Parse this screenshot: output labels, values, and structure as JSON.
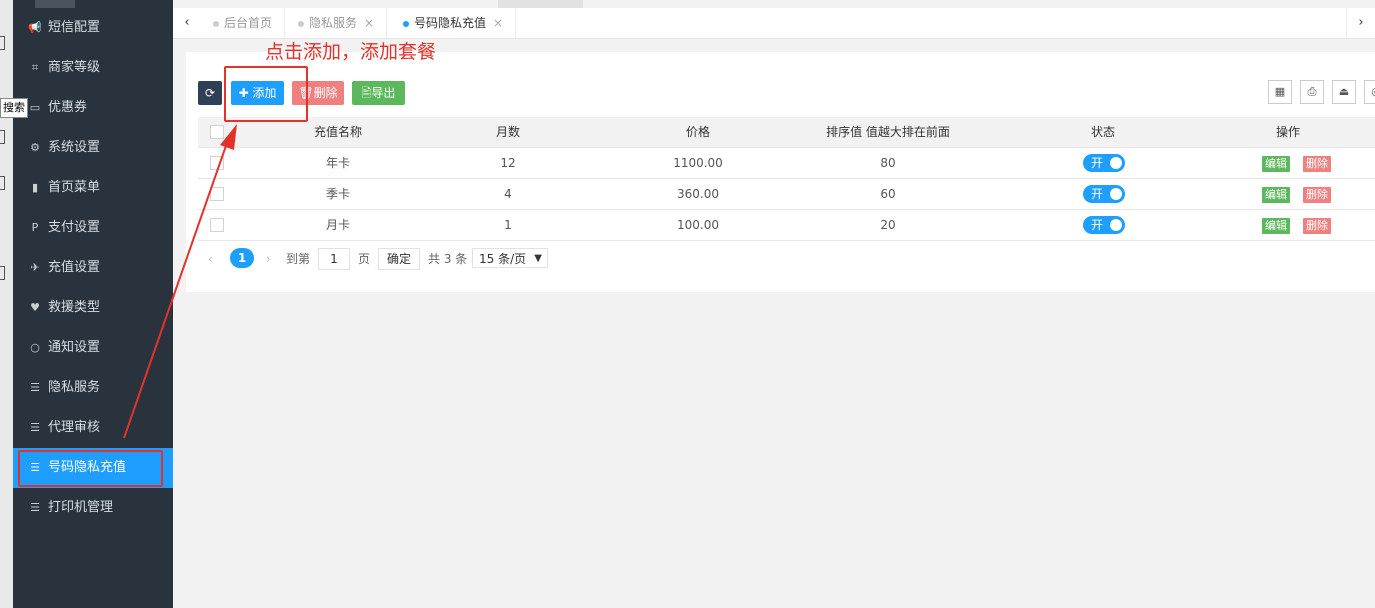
{
  "search_tip": "搜索",
  "sidebar": {
    "items": [
      {
        "icon": "megaphone-icon",
        "glyph": "📢",
        "label": "短信配置"
      },
      {
        "icon": "crop-icon",
        "glyph": "⌗",
        "label": "商家等级"
      },
      {
        "icon": "coupon-icon",
        "glyph": "▭",
        "label": "优惠券"
      },
      {
        "icon": "gear-icon",
        "glyph": "⚙",
        "label": "系统设置"
      },
      {
        "icon": "bookmark-icon",
        "glyph": "▮",
        "label": "首页菜单"
      },
      {
        "icon": "paypal-icon",
        "glyph": "P",
        "label": "支付设置"
      },
      {
        "icon": "recharge-icon",
        "glyph": "✈",
        "label": "充值设置"
      },
      {
        "icon": "heart-icon",
        "glyph": "♥",
        "label": "救援类型"
      },
      {
        "icon": "circle-icon",
        "glyph": "○",
        "label": "通知设置"
      },
      {
        "icon": "list-icon",
        "glyph": "☰",
        "label": "隐私服务"
      },
      {
        "icon": "list-icon",
        "glyph": "☰",
        "label": "代理审核"
      },
      {
        "icon": "list-icon",
        "glyph": "☰",
        "label": "号码隐私充值"
      },
      {
        "icon": "list-icon",
        "glyph": "☰",
        "label": "打印机管理"
      }
    ],
    "active_index": 11
  },
  "tabs": {
    "prev": "‹",
    "next": "›",
    "items": [
      {
        "label": "后台首页",
        "active": false,
        "closable": false
      },
      {
        "label": "隐私服务",
        "active": false,
        "closable": true
      },
      {
        "label": "号码隐私充值",
        "active": true,
        "closable": true
      }
    ],
    "close_glyph": "×"
  },
  "toolbar": {
    "refresh_glyph": "⟳",
    "add_label": "✚ 添加",
    "delete_label": "🗑删除",
    "export_label": "🖹导出",
    "tools": [
      {
        "icon": "columns-icon",
        "glyph": "▦"
      },
      {
        "icon": "print-icon",
        "glyph": "⎙"
      },
      {
        "icon": "export-icon",
        "glyph": "⏏"
      },
      {
        "icon": "search-icon",
        "glyph": "◎"
      }
    ]
  },
  "table": {
    "headers": [
      "充值名称",
      "月数",
      "价格",
      "排序值 值越大排在前面",
      "状态",
      "操作"
    ],
    "rows": [
      {
        "name": "年卡",
        "months": "12",
        "price": "1100.00",
        "sort": "80",
        "status": "开"
      },
      {
        "name": "季卡",
        "months": "4",
        "price": "360.00",
        "sort": "60",
        "status": "开"
      },
      {
        "name": "月卡",
        "months": "1",
        "price": "100.00",
        "sort": "20",
        "status": "开"
      }
    ],
    "edit_label": "编辑",
    "delete_label": "删除"
  },
  "pager": {
    "prev": "‹",
    "current": "1",
    "next": "›",
    "goto_label": "到第",
    "goto_value": "1",
    "page_label": "页",
    "confirm_label": "确定",
    "total": "共 3 条",
    "per_page": "15 条/页"
  },
  "annotation": {
    "text": "点击添加，添加套餐",
    "color": "#e4322b"
  }
}
